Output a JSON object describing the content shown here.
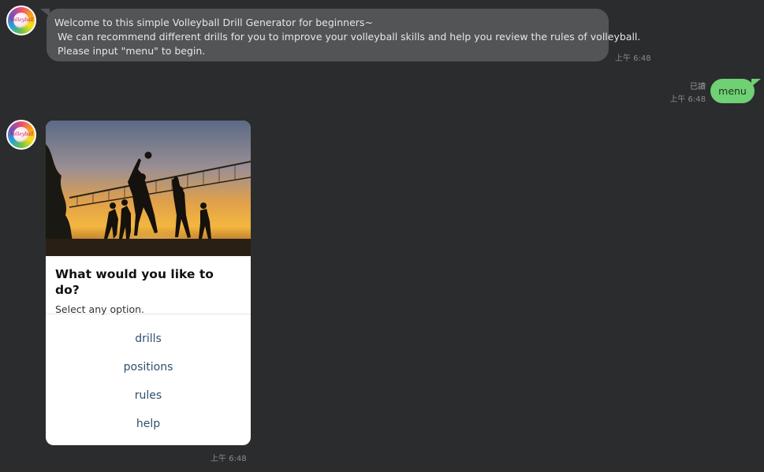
{
  "messages": {
    "welcome": {
      "lines": [
        "Welcome to this simple Volleyball Drill Generator for beginners~",
        "We can recommend different drills for you to improve your volleyball skills and help you review the rules of volleyball.",
        "Please input \"menu\" to begin."
      ],
      "time": "上午 6:48"
    },
    "user_reply": {
      "text": "menu",
      "read_label": "已讀",
      "time": "上午 6:48"
    },
    "menu_card": {
      "title": "What would you like to do?",
      "subtitle": "Select any option.",
      "actions": [
        "drills",
        "positions",
        "rules",
        "help"
      ],
      "time": "上午 6:48"
    }
  },
  "bot": {
    "avatar_icon": "volleyball-logo-icon",
    "avatar_text": "Volleyball"
  },
  "colors": {
    "background": "#2b2c2e",
    "incoming_bubble": "#525456",
    "outgoing_bubble": "#6fd074",
    "action_text": "#2f4f6e"
  }
}
